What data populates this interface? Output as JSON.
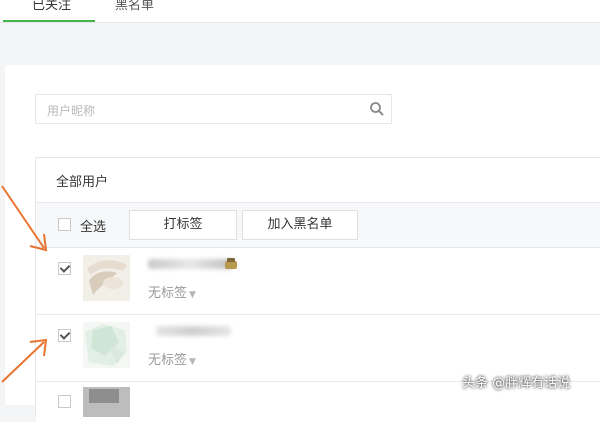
{
  "tabs": [
    {
      "label": "已关注"
    },
    {
      "label": "黑名单"
    }
  ],
  "search": {
    "placeholder": "用户昵称",
    "icon": "search-icon"
  },
  "list": {
    "title": "全部用户",
    "select_all_label": "全选",
    "tag_button_label": "打标签",
    "blacklist_button_label": "加入黑名单",
    "users": [
      {
        "tag_label": "无标签",
        "checked": true
      },
      {
        "tag_label": "无标签",
        "checked": true
      },
      {
        "tag_label": "",
        "checked": false
      }
    ]
  },
  "colors": {
    "accent": "#44b549",
    "annotation_arrow": "#e8742f"
  },
  "watermark": "头条 @胖辉有话说"
}
